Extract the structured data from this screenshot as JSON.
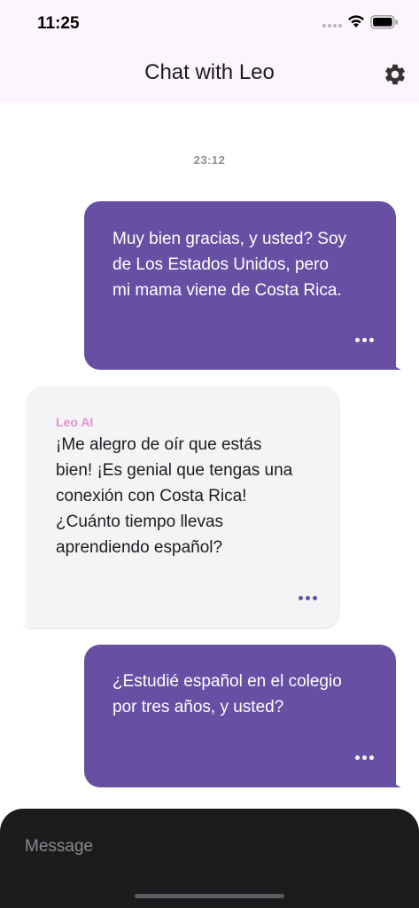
{
  "status_bar": {
    "time": "11:25"
  },
  "header": {
    "title": "Chat with Leo"
  },
  "timestamp": "23:12",
  "messages": [
    {
      "direction": "outgoing",
      "text": "Muy bien gracias, y usted? Soy\nde Los Estados Unidos, pero\nmi mama viene de Costa Rica."
    },
    {
      "direction": "incoming",
      "sender": "Leo AI",
      "text": "¡Me alegro de oír que estás\nbien! ¡Es genial que tengas una\nconexión con Costa Rica!\n¿Cuánto tiempo llevas\naprendiendo español?"
    },
    {
      "direction": "outgoing",
      "text": "¿Estudié español en el colegio\npor tres años, y usted?"
    }
  ],
  "composer": {
    "placeholder": "Message",
    "value": ""
  },
  "colors": {
    "outgoing_bubble": "#6750a4",
    "incoming_bubble": "#f4f4f6",
    "sender_name": "#e88fd0",
    "header_bg": "#fcf5fb",
    "composer_bg": "#1c1c1e"
  },
  "icons": {
    "settings": "gear-icon",
    "more": "more-horizontal-icon",
    "wifi": "wifi-icon",
    "battery": "battery-icon"
  }
}
